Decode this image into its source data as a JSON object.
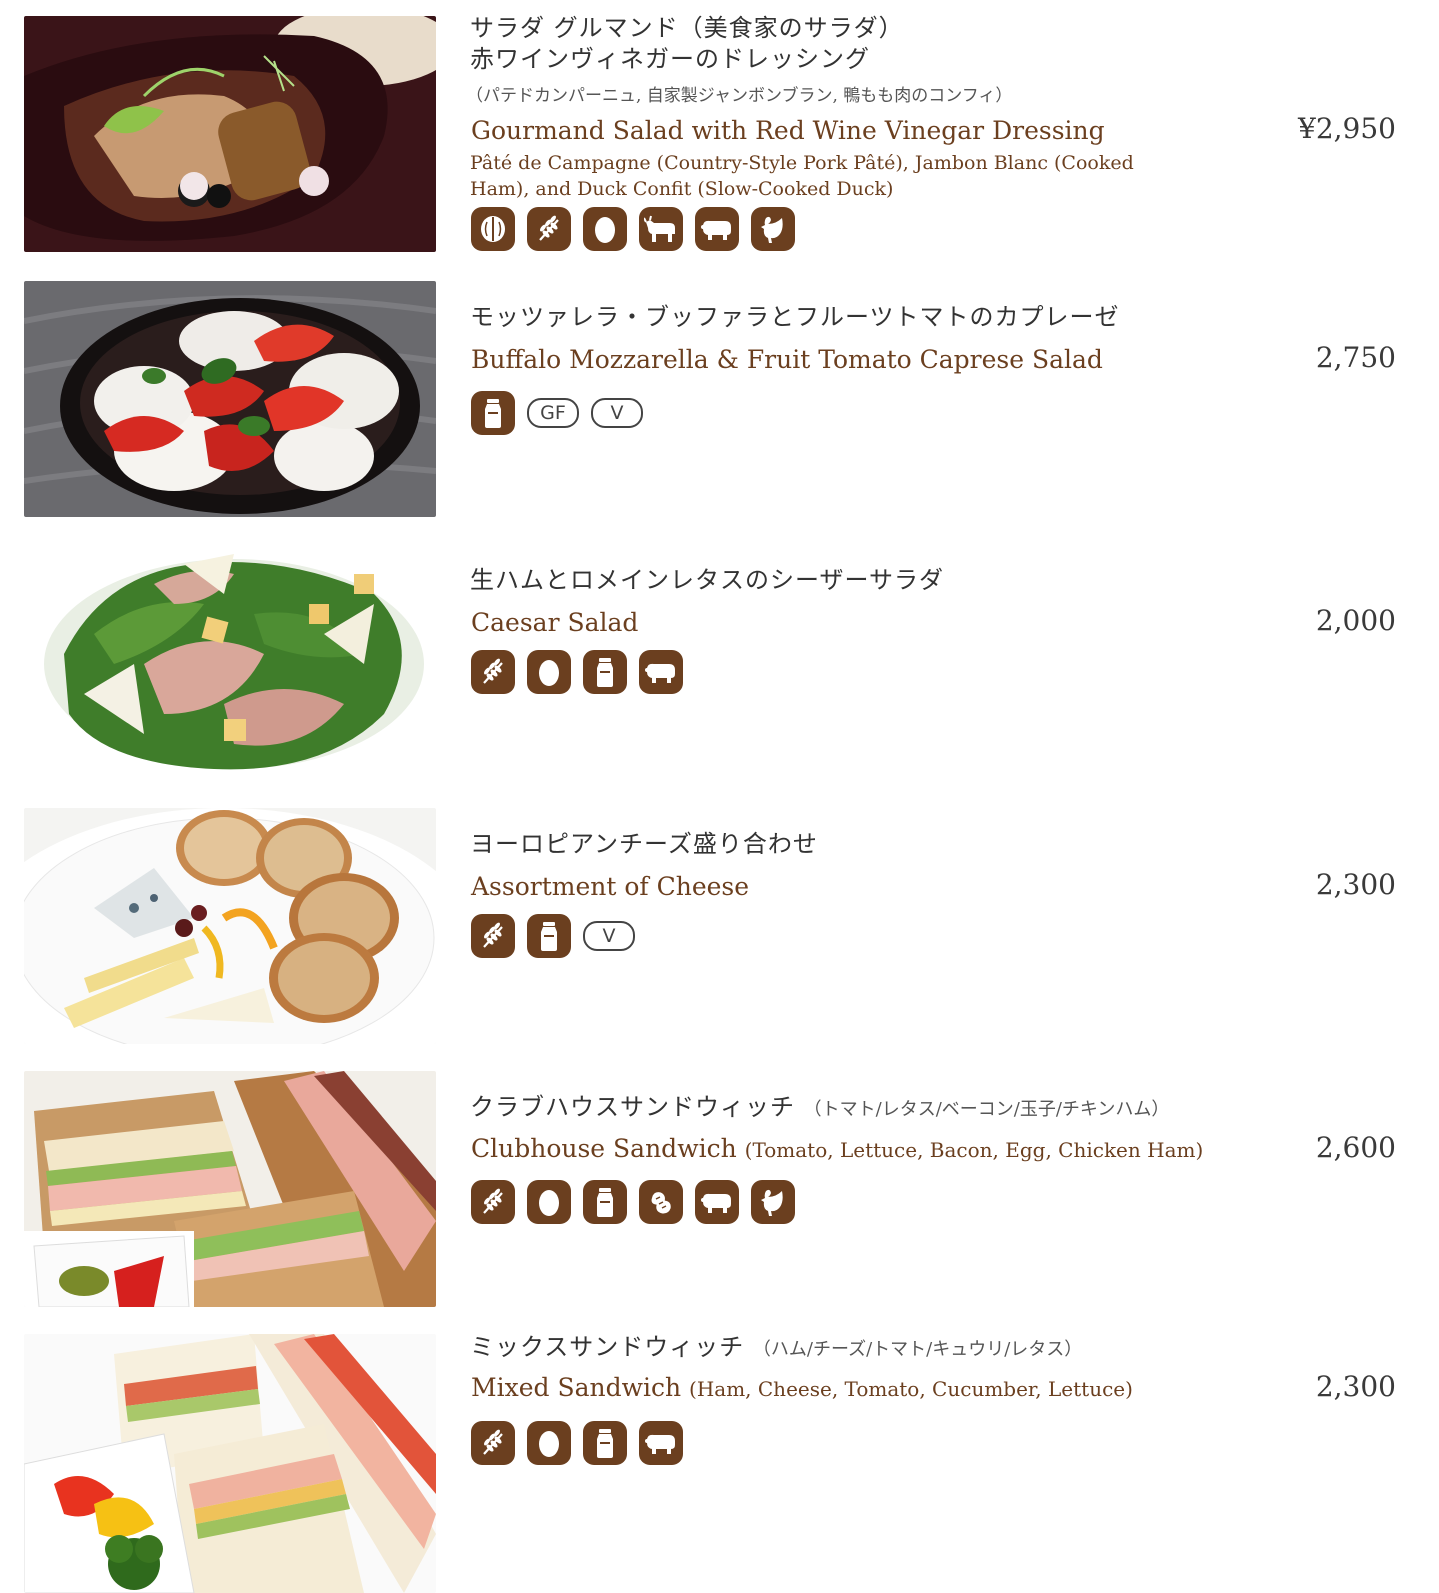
{
  "items": [
    {
      "ja_title_1": "サラダ グルマンド（美食家のサラダ）",
      "ja_title_2": "赤ワインヴィネガーのドレッシング",
      "ja_note": "（パテドカンパーニュ, 自家製ジャンボンブラン, 鴨もも肉のコンフィ）",
      "en_title": "Gourmand Salad with Red Wine Vinegar Dressing",
      "en_desc": "Pâté de Campagne (Country-Style Pork Pâté), Jambon Blanc (Cooked Ham), and Duck Confit (Slow-Cooked Duck)",
      "price": "¥2,950",
      "icons": [
        "walnut-icon",
        "wheat-icon",
        "egg-icon",
        "beef-icon",
        "pork-icon",
        "chicken-icon"
      ]
    },
    {
      "ja_title_1": "モッツァレラ・ブッファラとフルーツトマトのカプレーゼ",
      "en_title": "Buffalo Mozzarella & Fruit Tomato Caprese Salad",
      "price": "2,750",
      "icons": [
        "milk-icon"
      ],
      "badges": [
        "GF",
        "V"
      ]
    },
    {
      "ja_title_1": "生ハムとロメインレタスのシーザーサラダ",
      "en_title": "Caesar Salad",
      "price": "2,000",
      "icons": [
        "wheat-icon",
        "egg-icon",
        "milk-icon",
        "pork-icon"
      ]
    },
    {
      "ja_title_1": "ヨーロピアンチーズ盛り合わせ",
      "en_title": "Assortment of Cheese",
      "price": "2,300",
      "icons": [
        "wheat-icon",
        "milk-icon"
      ],
      "badges": [
        "V"
      ]
    },
    {
      "ja_title_1": "クラブハウスサンドウィッチ",
      "ja_sub": "（トマト/レタス/ベーコン/玉子/チキンハム）",
      "en_title": "Clubhouse Sandwich",
      "en_sub": "(Tomato, Lettuce, Bacon, Egg, Chicken Ham)",
      "price": "2,600",
      "icons": [
        "wheat-icon",
        "egg-icon",
        "milk-icon",
        "peanut-icon",
        "pork-icon",
        "chicken-icon"
      ]
    },
    {
      "ja_title_1": "ミックスサンドウィッチ",
      "ja_sub": "（ハム/チーズ/トマト/キュウリ/レタス）",
      "en_title": "Mixed Sandwich",
      "en_sub": "(Ham, Cheese, Tomato, Cucumber, Lettuce)",
      "price": "2,300",
      "icons": [
        "wheat-icon",
        "egg-icon",
        "milk-icon",
        "pork-icon"
      ]
    }
  ],
  "colors": {
    "accent_brown": "#6b3f1f",
    "price_text": "#3a3a3a"
  }
}
